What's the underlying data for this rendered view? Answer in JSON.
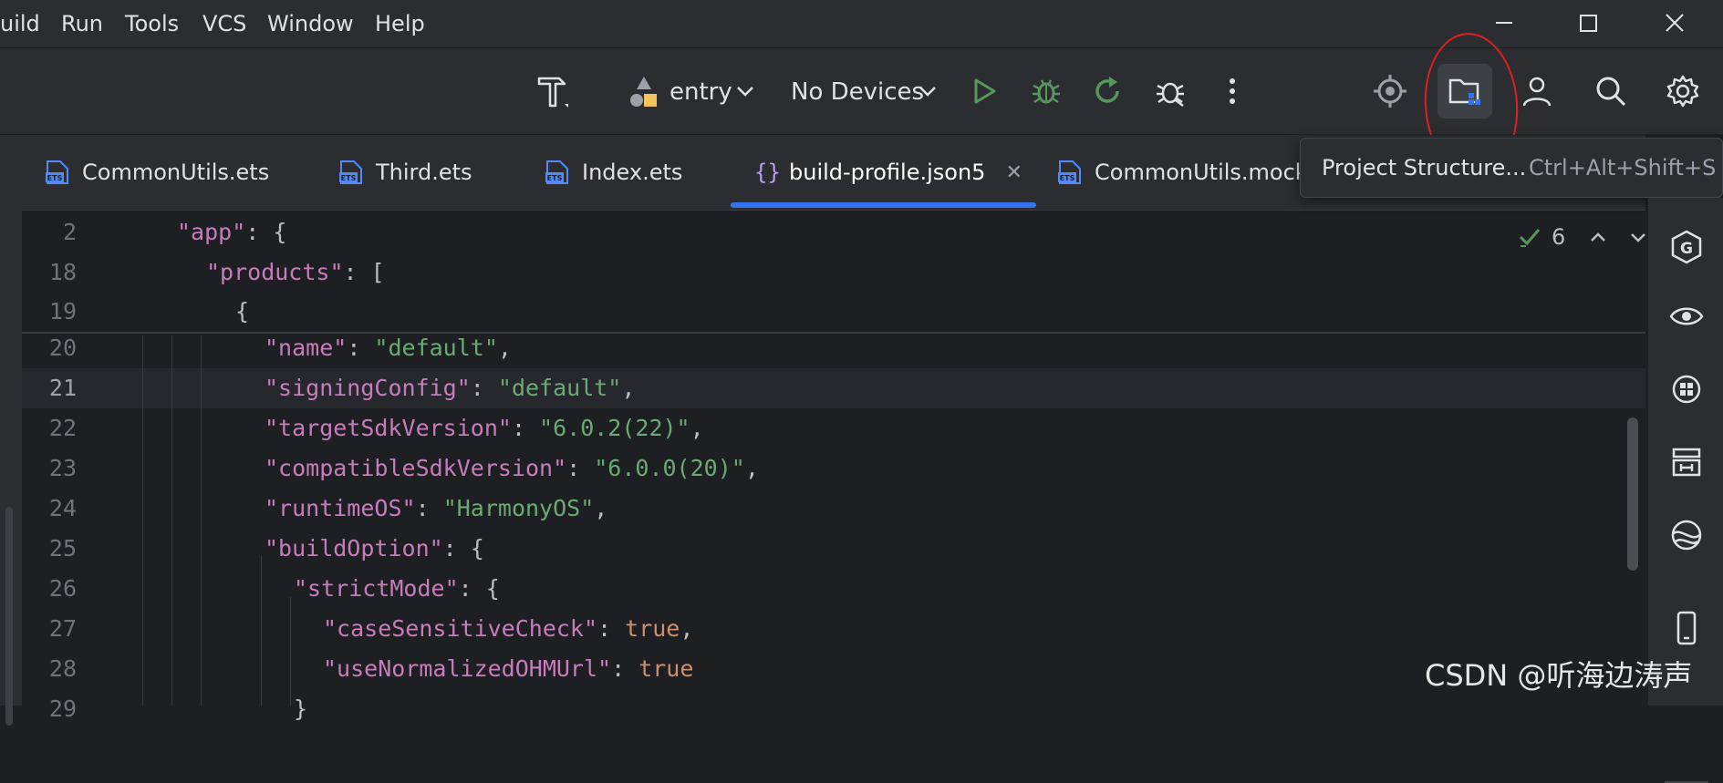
{
  "menu": {
    "items": [
      {
        "label": "uild"
      },
      {
        "label": "Run"
      },
      {
        "label": "Tools"
      },
      {
        "label": "VCS"
      },
      {
        "label": "Window"
      },
      {
        "label": "Help"
      }
    ]
  },
  "window_controls": [
    "minimize-icon",
    "maximize-icon",
    "close-icon"
  ],
  "toolbar": {
    "build_icon": "hammer-icon",
    "module": "entry",
    "device": "No Devices",
    "actions": [
      "run-icon",
      "debug-icon",
      "rerun-icon",
      "attach-debugger-icon",
      "more-icon"
    ],
    "right_actions": [
      "locate-icon",
      "project-structure-icon",
      "account-icon",
      "search-icon",
      "settings-icon"
    ]
  },
  "tabs": [
    {
      "label": "CommonUtils.ets",
      "icon": "ets-file-icon"
    },
    {
      "label": "Third.ets",
      "icon": "ets-file-icon"
    },
    {
      "label": "Index.ets",
      "icon": "ets-file-icon"
    },
    {
      "label": "build-profile.json5",
      "icon": "json-file-icon",
      "active": true
    },
    {
      "label": "CommonUtils.mock",
      "icon": "ets-file-icon"
    }
  ],
  "tooltip": {
    "label": "Project Structure...",
    "shortcut": "Ctrl+Alt+Shift+S"
  },
  "inspection": {
    "count": "6"
  },
  "editor": {
    "lines": [
      {
        "num": "2",
        "tokens": [
          [
            "k",
            "\"app\""
          ],
          [
            "p",
            ": {"
          ]
        ]
      },
      {
        "num": "18",
        "tokens": [
          [
            "k",
            "\"products\""
          ],
          [
            "p",
            ": ["
          ]
        ]
      },
      {
        "num": "19",
        "tokens": [
          [
            "p",
            "{"
          ]
        ]
      },
      {
        "num": "20",
        "tokens": [
          [
            "k",
            "\"name\""
          ],
          [
            "p",
            ": "
          ],
          [
            "s",
            "\"default\""
          ],
          [
            "p",
            ","
          ]
        ]
      },
      {
        "num": "21",
        "tokens": [
          [
            "k",
            "\"signingConfig\""
          ],
          [
            "p",
            ": "
          ],
          [
            "s",
            "\"default\""
          ],
          [
            "p",
            ","
          ]
        ]
      },
      {
        "num": "22",
        "tokens": [
          [
            "k",
            "\"targetSdkVersion\""
          ],
          [
            "p",
            ": "
          ],
          [
            "s",
            "\"6.0.2(22)\""
          ],
          [
            "p",
            ","
          ]
        ]
      },
      {
        "num": "23",
        "tokens": [
          [
            "k",
            "\"compatibleSdkVersion\""
          ],
          [
            "p",
            ": "
          ],
          [
            "s",
            "\"6.0.0(20)\""
          ],
          [
            "p",
            ","
          ]
        ]
      },
      {
        "num": "24",
        "tokens": [
          [
            "k",
            "\"runtimeOS\""
          ],
          [
            "p",
            ": "
          ],
          [
            "s",
            "\"HarmonyOS\""
          ],
          [
            "p",
            ","
          ]
        ]
      },
      {
        "num": "25",
        "tokens": [
          [
            "k",
            "\"buildOption\""
          ],
          [
            "p",
            ": {"
          ]
        ]
      },
      {
        "num": "26",
        "tokens": [
          [
            "k",
            "\"strictMode\""
          ],
          [
            "p",
            ": {"
          ]
        ]
      },
      {
        "num": "27",
        "tokens": [
          [
            "k",
            "\"caseSensitiveCheck\""
          ],
          [
            "p",
            ": "
          ],
          [
            "b",
            "true"
          ],
          [
            "p",
            ","
          ]
        ]
      },
      {
        "num": "28",
        "tokens": [
          [
            "k",
            "\"useNormalizedOHMUrl\""
          ],
          [
            "p",
            ": "
          ],
          [
            "b",
            "true"
          ]
        ]
      },
      {
        "num": "29",
        "tokens": [
          [
            "p",
            "}"
          ]
        ]
      }
    ]
  },
  "right_sidebar": [
    "codegenie-icon",
    "preview-icon",
    "app-analyzer-icon",
    "device-manager-icon",
    "network-icon",
    "device-icon"
  ],
  "watermark": "CSDN @听海边涛声",
  "colors": {
    "accent": "#3574f0",
    "key": "#c77dbb",
    "string": "#6aab73",
    "boolean": "#cf8e6d",
    "annotation": "#e02020"
  }
}
